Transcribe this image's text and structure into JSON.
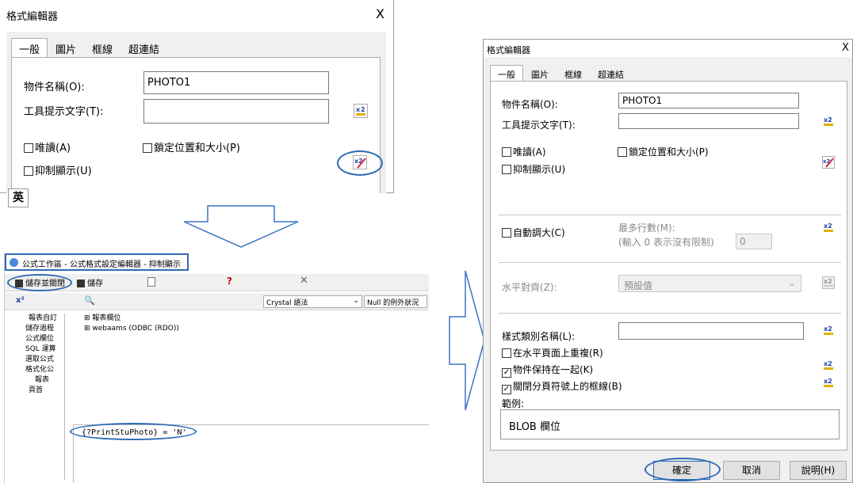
{
  "left_dialog": {
    "title": "格式編輯器",
    "close": "X",
    "tabs": [
      "一般",
      "圖片",
      "框線",
      "超連結"
    ],
    "object_name_label": "物件名稱(O):",
    "object_name_value": "PHOTO1",
    "tooltip_label": "工具提示文字(T):",
    "readonly_label": "唯讀(A)",
    "lock_label": "鎖定位置和大小(P)",
    "suppress_label": "抑制顯示(U)",
    "ime_indicator": "英"
  },
  "workspace": {
    "title": "公式工作區 - 公式格式設定編輯器 - 抑制顯示",
    "save_close": "儲存並關閉",
    "save": "儲存",
    "syntax": "Crystal 語法",
    "null_handling": "Null 的例外狀況",
    "tree_items": [
      "報表自訂",
      "儲存過程",
      "公式欄位",
      "SQL 運算",
      "選取公式",
      "格式化公",
      "報表",
      "頁首"
    ],
    "field_tree": [
      "報表欄位",
      "webaams (ODBC (RDO))"
    ],
    "formula": "{?PrintStuPhoto} = 'N'"
  },
  "right_dialog": {
    "title": "格式編輯器",
    "close": "X",
    "tabs": [
      "一般",
      "圖片",
      "框線",
      "超連結"
    ],
    "object_name_label": "物件名稱(O):",
    "object_name_value": "PHOTO1",
    "tooltip_label": "工具提示文字(T):",
    "readonly_label": "唯讀(A)",
    "lock_label": "鎖定位置和大小(P)",
    "suppress_label": "抑制顯示(U)",
    "autogrow_label": "自動調大(C)",
    "max_lines_label": "最多行數(M):",
    "max_lines_hint": "(輸入 0 表示沒有限制)",
    "max_lines_value": "0",
    "h_align_label": "水平對齊(Z):",
    "h_align_value": "預設值",
    "style_name_label": "樣式類別名稱(L):",
    "repeat_label": "在水平頁面上重複(R)",
    "keep_together_label": "物件保持在一起(K)",
    "close_border_label": "關閉分頁符號上的框線(B)",
    "sample_label": "範例:",
    "sample_value": "BLOB 欄位",
    "ok": "確定",
    "cancel": "取消",
    "help": "說明(H)"
  },
  "colors": {
    "accent_blue": "#2e6ab5",
    "arrow_blue": "#3b73c4"
  }
}
